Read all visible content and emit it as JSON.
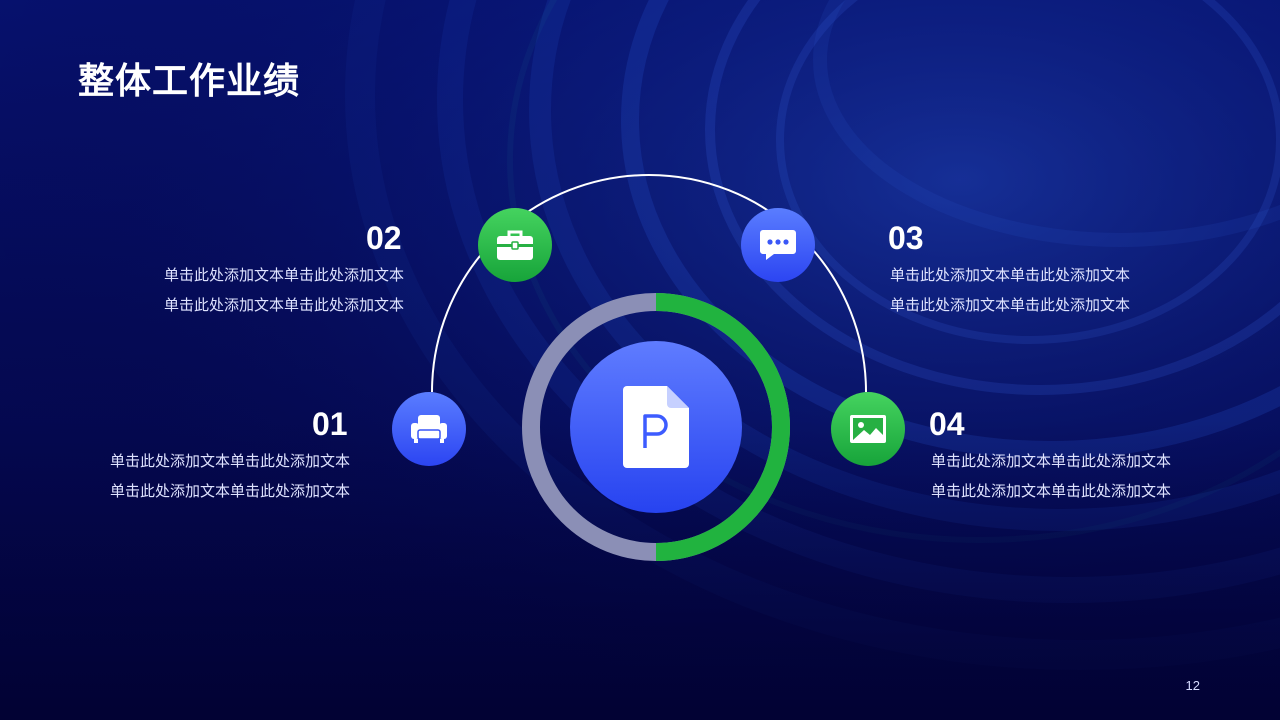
{
  "slide": {
    "title": "整体工作业绩",
    "page_number": "12",
    "center_icon": "powerpoint-file-icon",
    "ring_colors": {
      "track": "#8b8fb6",
      "progress": "#21b33f"
    },
    "items": [
      {
        "number": "01",
        "icon": "sofa-icon",
        "color": "#3150f5",
        "lines": [
          "单击此处添加文本单击此处添加文本",
          "单击此处添加文本单击此处添加文本"
        ]
      },
      {
        "number": "02",
        "icon": "briefcase-icon",
        "color": "#21b33f",
        "lines": [
          "单击此处添加文本单击此处添加文本",
          "单击此处添加文本单击此处添加文本"
        ]
      },
      {
        "number": "03",
        "icon": "chat-bubble-icon",
        "color": "#3150f5",
        "lines": [
          "单击此处添加文本单击此处添加文本",
          "单击此处添加文本单击此处添加文本"
        ]
      },
      {
        "number": "04",
        "icon": "image-icon",
        "color": "#21b33f",
        "lines": [
          "单击此处添加文本单击此处添加文本",
          "单击此处添加文本单击此处添加文本"
        ]
      }
    ]
  }
}
